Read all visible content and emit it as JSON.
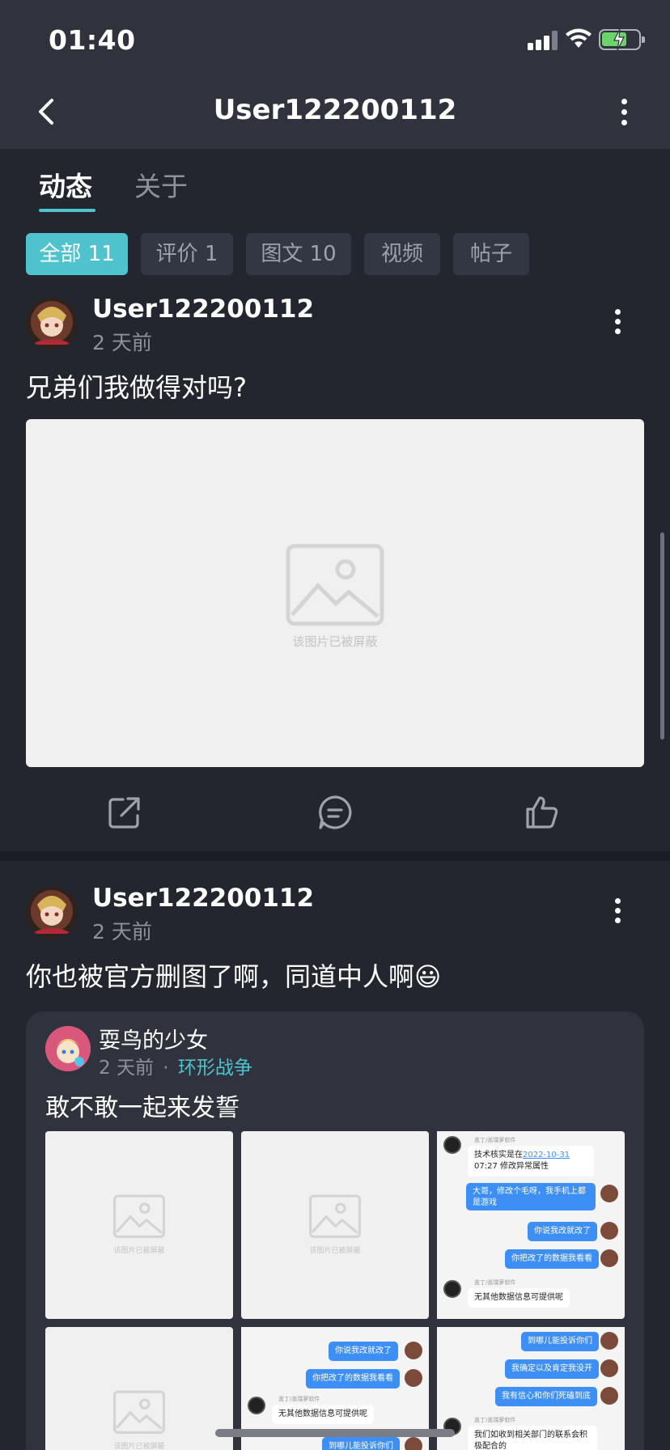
{
  "status": {
    "time": "01:40"
  },
  "nav": {
    "title": "User122200112"
  },
  "tabs": [
    {
      "label": "动态"
    },
    {
      "label": "关于"
    }
  ],
  "filters": [
    {
      "label": "全部 11"
    },
    {
      "label": "评价 1"
    },
    {
      "label": "图文 10"
    },
    {
      "label": "视频"
    },
    {
      "label": "帖子"
    }
  ],
  "posts": [
    {
      "user": "User122200112",
      "time": "2 天前",
      "text": "兄弟们我做得对吗?",
      "image_caption": "该图片已被屏蔽"
    },
    {
      "user": "User122200112",
      "time": "2 天前",
      "text": "你也被官方删图了啊，同道中人啊😃",
      "shared": {
        "user": "耍鸟的少女",
        "time": "2 天前",
        "separator": "·",
        "topic": "环形战争",
        "text": "敢不敢一起来发誓",
        "image_caption": "该图片已被屏蔽",
        "chat1": {
          "bot_name": "盖丁/盖瑞萝软件",
          "msg1_pre": "技术核实是在",
          "msg1_date": "2022-10-31",
          "msg1_post": " 07:27 修改异常属性",
          "r1": "大哥，修改个毛呀，我手机上都是游戏",
          "r2": "你说我改就改了",
          "r3": "你把改了的数据我看看",
          "bot_name2": "盖丁/盖瑞萝软件",
          "l2": "无其他数据信息可提供呢"
        },
        "chat2": {
          "r1": "你说我改就改了",
          "r2": "你把改了的数据我看看",
          "bot_name": "盖丁/盖瑞萝软件",
          "l1": "无其他数据信息可提供呢",
          "r3": "到哪儿能投诉你们"
        },
        "chat3": {
          "r1": "到哪儿能投诉你们",
          "r2": "我确定以及肯定我没开",
          "r3": "我有信心和你们死磕到底",
          "bot_name": "盖丁/盖瑞萝软件",
          "l1": "我们如收到相关部门的联系会积极配合的"
        }
      }
    }
  ],
  "colors": {
    "accent": "#4fc3cd",
    "background": "#23252f",
    "header": "#30333e"
  }
}
